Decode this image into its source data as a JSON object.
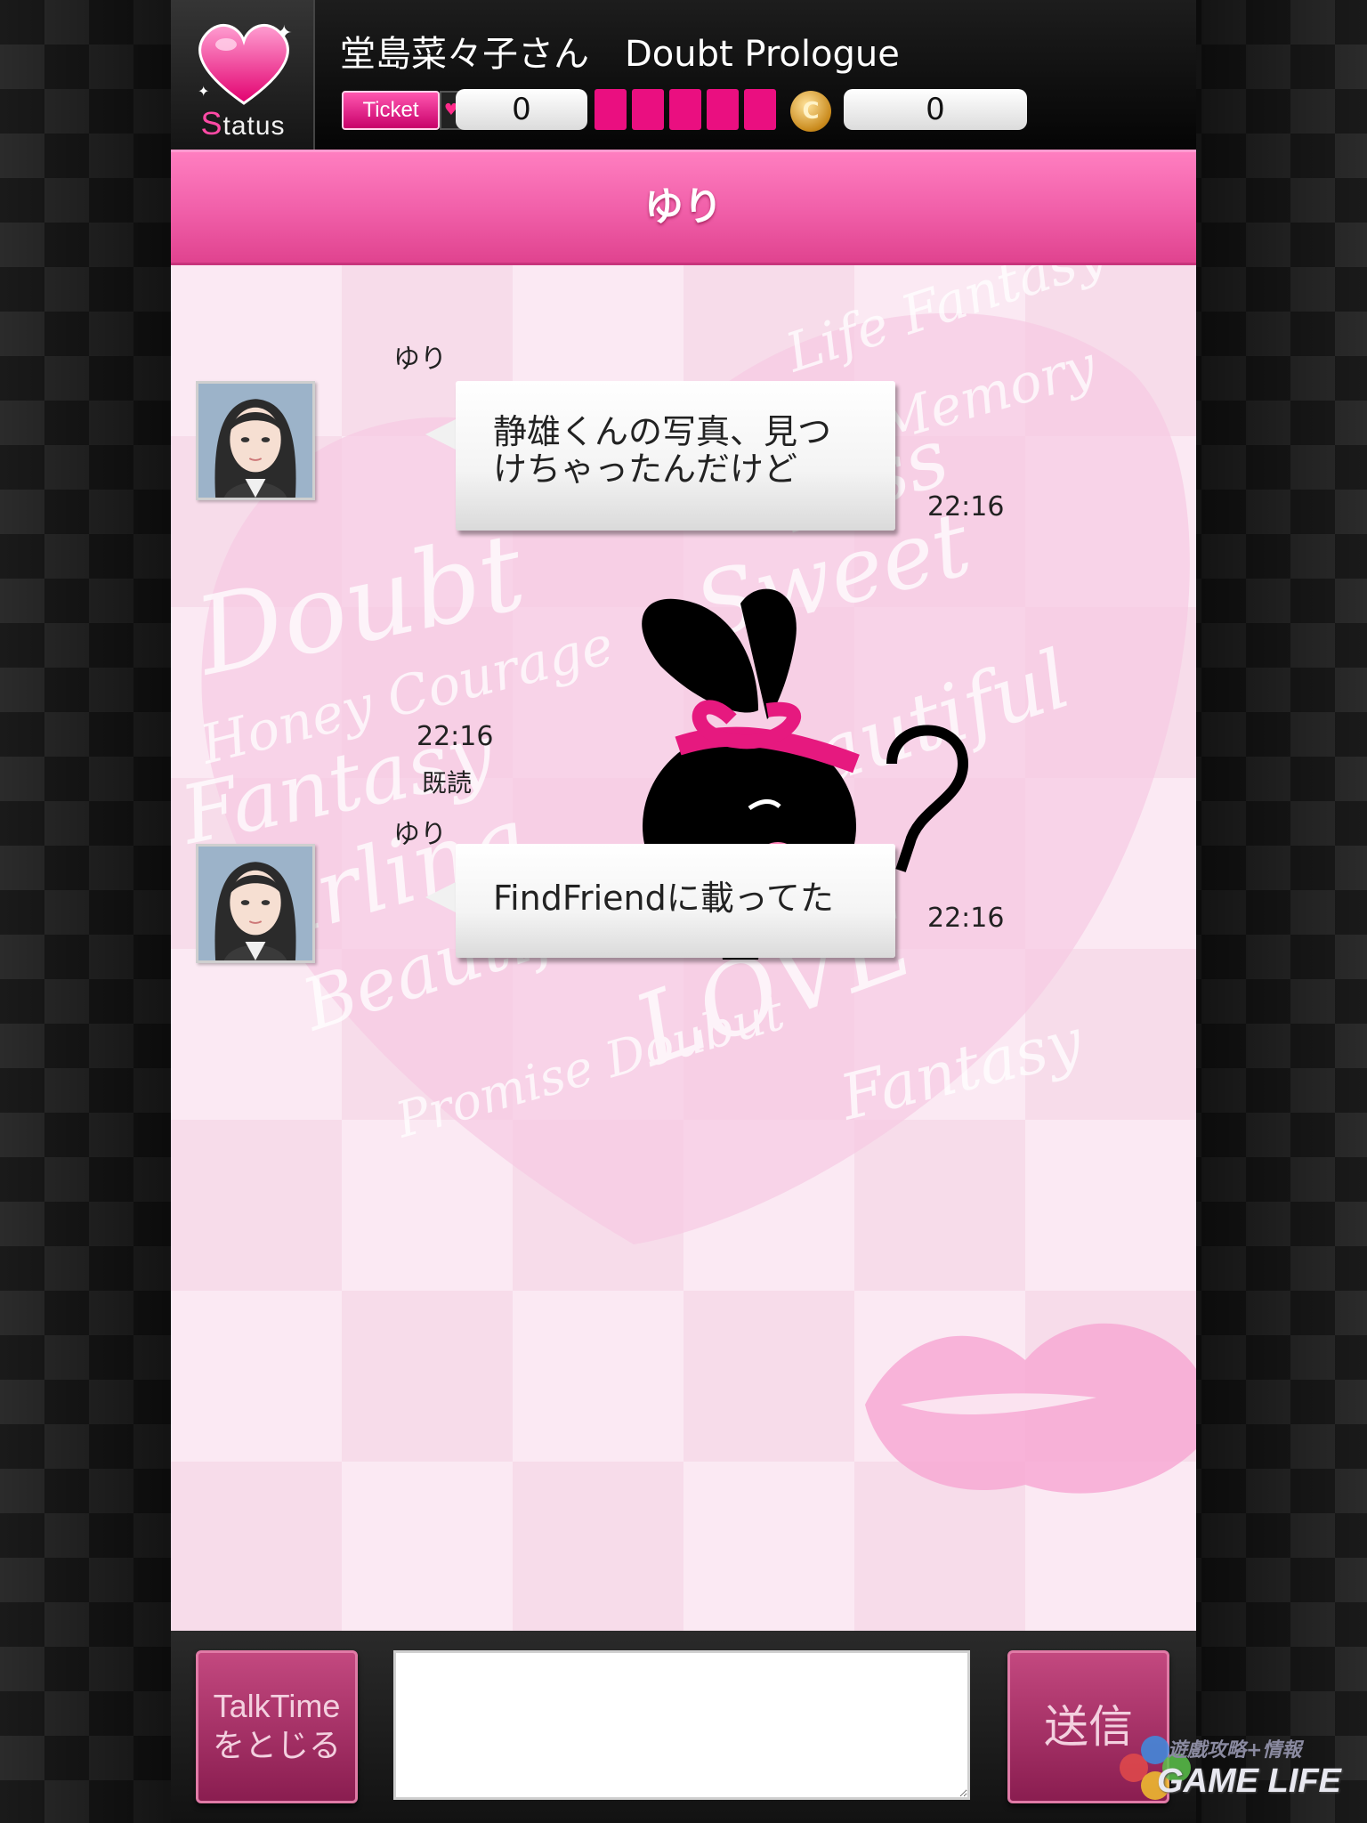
{
  "topbar": {
    "status_button": {
      "label_first": "S",
      "label_rest": "tatus"
    },
    "player_name": "堂島菜々子さん",
    "story_title": "Doubt Prologue",
    "ticket_badge": "Ticket",
    "ticket_count": "0",
    "life_hearts_filled": 5,
    "coin_symbol": "C",
    "coin_count": "0"
  },
  "chat_header": {
    "title": "ゆり"
  },
  "messages": [
    {
      "sender": "ゆり",
      "type": "text",
      "text": "静雄くんの写真、見つけちゃったんだけど",
      "time": "22:16"
    },
    {
      "sender": "ゆり",
      "type": "sticker",
      "sticker": "black-bunny-question-sticker",
      "time": "22:16",
      "read": "既読"
    },
    {
      "sender": "ゆり",
      "type": "text",
      "text": "FindFriendに載ってた",
      "time": "22:16"
    }
  ],
  "input_bar": {
    "close_button": "TalkTime\nをとじる",
    "message_value": "",
    "send_button": "送信"
  },
  "watermark": {
    "top": "遊戲攻略+情報",
    "bottom": "GAME LIFE"
  },
  "colors": {
    "accent_pink": "#f05ea8",
    "heart_pink": "#ea0f80",
    "button_pink": "#a83168"
  }
}
